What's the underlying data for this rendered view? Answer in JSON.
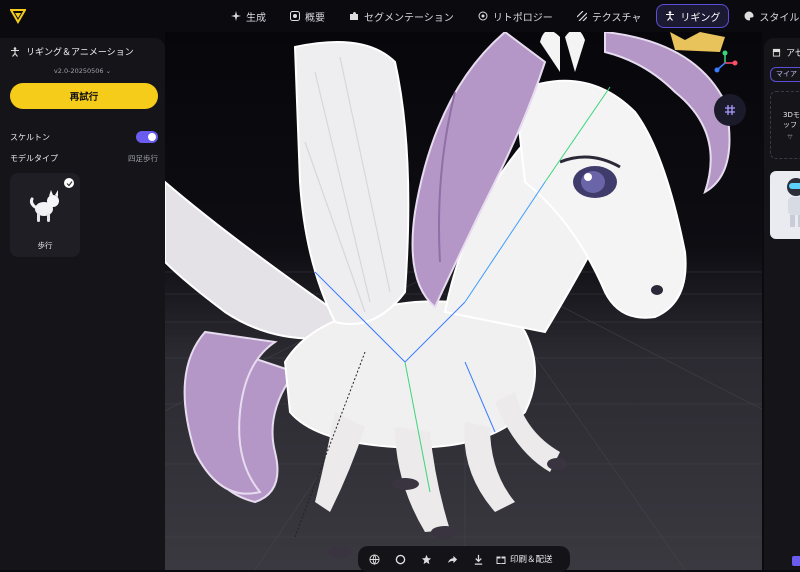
{
  "nav": {
    "items": [
      {
        "label": "生成",
        "icon": "sparkle-icon"
      },
      {
        "label": "概要",
        "icon": "overview-icon"
      },
      {
        "label": "セグメンテーション",
        "icon": "puzzle-icon"
      },
      {
        "label": "リトポロジー",
        "icon": "topology-icon"
      },
      {
        "label": "テクスチャ",
        "icon": "texture-icon"
      },
      {
        "label": "リギング",
        "icon": "rigging-icon",
        "active": true
      },
      {
        "label": "スタイル変換",
        "icon": "palette-icon"
      }
    ]
  },
  "left_panel": {
    "title": "リギング＆アニメーション",
    "version": "v2.0-20250506",
    "retry_label": "再試行",
    "skeleton_label": "スケルトン",
    "skeleton_on": true,
    "model_type_label": "モデルタイプ",
    "model_type_value": "四足歩行",
    "card_label": "歩行"
  },
  "right_panel": {
    "title": "アセ",
    "tab_label": "マイア",
    "card_title_line1": "3Dモ",
    "card_title_line2": "ッフ",
    "card_sub": "サ"
  },
  "toolbar": {
    "print_label": "印刷＆配送"
  },
  "colors": {
    "accent": "#6b5cf0",
    "retry": "#f5cc19"
  }
}
